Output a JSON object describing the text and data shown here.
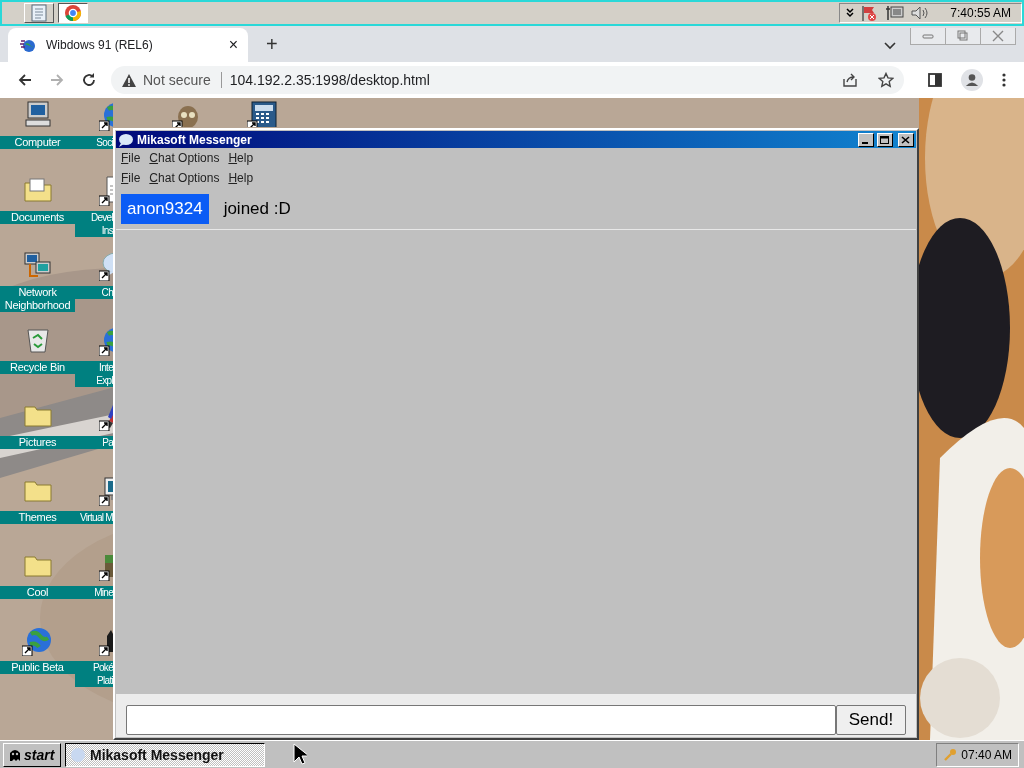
{
  "host_taskbar": {
    "buttons": [
      {
        "kind": "notepad",
        "selected": false
      },
      {
        "kind": "chrome",
        "selected": true
      }
    ],
    "tray": {
      "time": "7:40:55 AM"
    }
  },
  "browser": {
    "tabs": [
      {
        "title": "Wibdows 91 (REL6)",
        "close": "×",
        "selected": true
      }
    ],
    "new_tab": "+",
    "forward_disabled": true,
    "security": "Not secure",
    "url": "104.192.2.35:1998/desktop.html"
  },
  "desktop": {
    "icon_columns": [
      {
        "icons": [
          {
            "kind": "computer",
            "label": "Computer",
            "shortcut": false
          },
          {
            "kind": "folder-docs",
            "label": "Documents",
            "shortcut": false
          },
          {
            "kind": "network",
            "label": "Network Neighborhood",
            "shortcut": false
          },
          {
            "kind": "recycle",
            "label": "Recycle Bin",
            "shortcut": false
          },
          {
            "kind": "folder",
            "label": "Pictures",
            "shortcut": false
          },
          {
            "kind": "folder",
            "label": "Themes",
            "shortcut": false
          },
          {
            "kind": "folder",
            "label": "Cool",
            "shortcut": false
          },
          {
            "kind": "globe",
            "label": "Public Beta",
            "shortcut": true
          }
        ]
      },
      {
        "icons": [
          {
            "kind": "globe",
            "label": "Soci",
            "shortcut": true
          },
          {
            "kind": "document",
            "label": "Devel\nIns",
            "shortcut": true
          },
          {
            "kind": "bubble",
            "label": "Ch",
            "shortcut": true
          },
          {
            "kind": "globe",
            "label": "Inte\nExpl",
            "shortcut": true
          },
          {
            "kind": "brush",
            "label": "Pa",
            "shortcut": true
          },
          {
            "kind": "monitor",
            "label": "Virtual M",
            "shortcut": true
          },
          {
            "kind": "block",
            "label": "Mine",
            "shortcut": true
          },
          {
            "kind": "cat",
            "label": "Poké\nPlati",
            "shortcut": true
          }
        ]
      },
      {
        "icons": [
          {
            "kind": "creature",
            "shortcut": true
          }
        ]
      },
      {
        "icons": [
          {
            "kind": "calculator",
            "shortcut": true
          }
        ]
      }
    ]
  },
  "messenger": {
    "title": "Mikasoft Messenger",
    "menu_bars": [
      {
        "items": [
          "File",
          "Chat Options",
          "Help"
        ]
      },
      {
        "items": [
          "File",
          "Chat Options",
          "Help"
        ]
      }
    ],
    "messages": [
      {
        "user": "anon9324",
        "text": "joined :D"
      }
    ],
    "send_button": "Send!"
  },
  "guest_taskbar": {
    "start": "start",
    "tasks": [
      {
        "label": "Mikasoft Messenger",
        "selected": true
      }
    ],
    "clock": "07:40 AM"
  }
}
